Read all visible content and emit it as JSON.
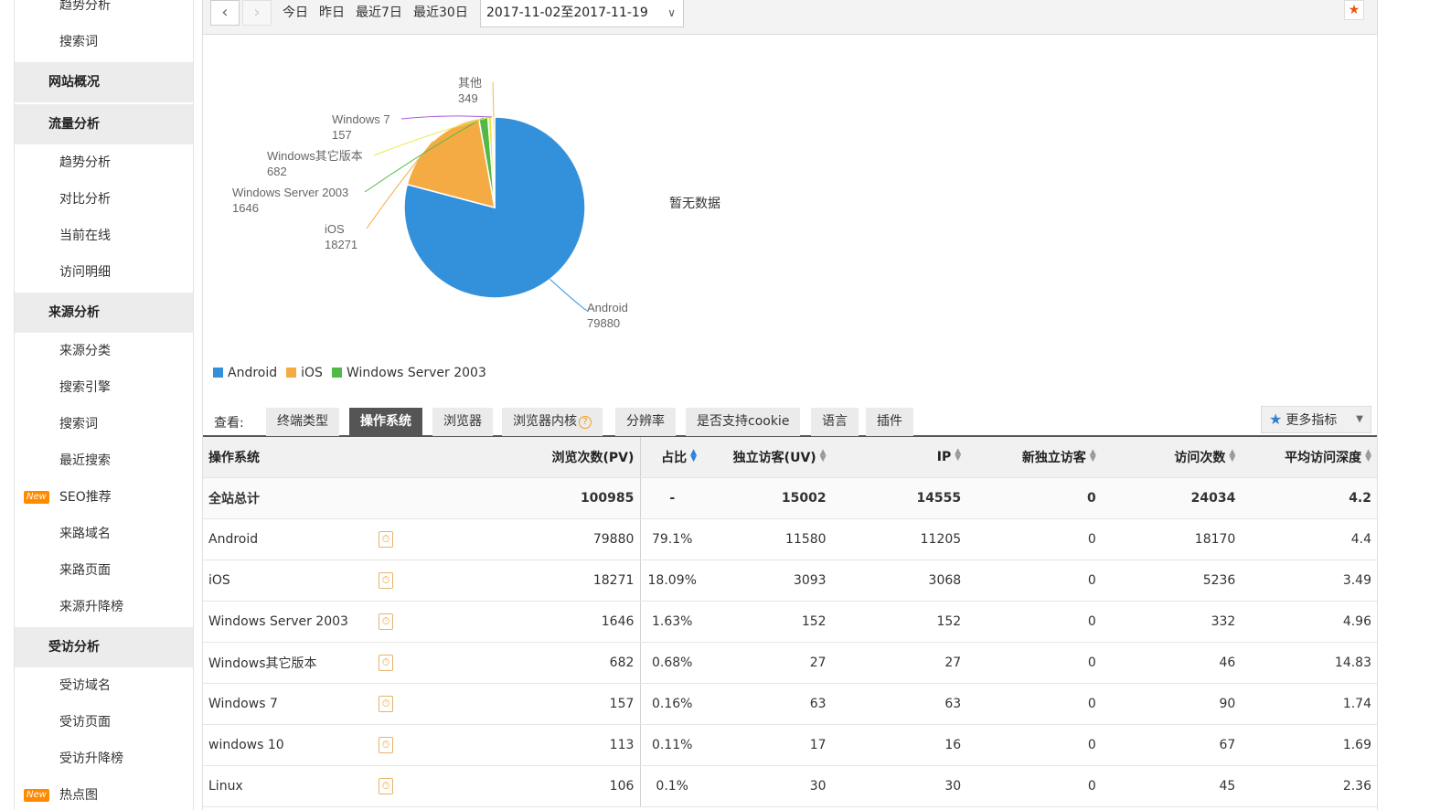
{
  "sidebar": {
    "items": [
      {
        "label": "趋势分析",
        "type": "item"
      },
      {
        "label": "搜索词",
        "type": "item"
      },
      {
        "label": "网站概况",
        "type": "group"
      },
      {
        "label": "流量分析",
        "type": "group"
      },
      {
        "label": "趋势分析",
        "type": "item"
      },
      {
        "label": "对比分析",
        "type": "item"
      },
      {
        "label": "当前在线",
        "type": "item"
      },
      {
        "label": "访问明细",
        "type": "item"
      },
      {
        "label": "来源分析",
        "type": "group"
      },
      {
        "label": "来源分类",
        "type": "item"
      },
      {
        "label": "搜索引擎",
        "type": "item"
      },
      {
        "label": "搜索词",
        "type": "item"
      },
      {
        "label": "最近搜索",
        "type": "item"
      },
      {
        "label": "SEO推荐",
        "type": "item",
        "badge": "New"
      },
      {
        "label": "来路域名",
        "type": "item"
      },
      {
        "label": "来路页面",
        "type": "item"
      },
      {
        "label": "来源升降榜",
        "type": "item"
      },
      {
        "label": "受访分析",
        "type": "group"
      },
      {
        "label": "受访域名",
        "type": "item"
      },
      {
        "label": "受访页面",
        "type": "item"
      },
      {
        "label": "受访升降榜",
        "type": "item"
      },
      {
        "label": "热点图",
        "type": "item",
        "badge": "New"
      }
    ]
  },
  "toolbar": {
    "prev_icon": "chevron-left-icon",
    "next_icon": "chevron-right-icon",
    "today": "今日",
    "yesterday": "昨日",
    "last7": "最近7日",
    "last30": "最近30日",
    "date_range": "2017-11-02至2017-11-19",
    "pin_icon": "pin-icon"
  },
  "chart_data": {
    "type": "pie",
    "slices": [
      {
        "label": "Android",
        "value": 79880,
        "color": "#3391db"
      },
      {
        "label": "iOS",
        "value": 18271,
        "color": "#f5ab43"
      },
      {
        "label": "Windows Server 2003",
        "value": 1646,
        "color": "#52b947"
      },
      {
        "label": "Windows其它版本",
        "value": 682,
        "color": "#e9e94b"
      },
      {
        "label": "Windows 7",
        "value": 157,
        "color": "#a958d6"
      },
      {
        "label": "其他",
        "value": 349,
        "color": "#f4b84a"
      }
    ],
    "legend": [
      "Android",
      "iOS",
      "Windows Server 2003"
    ],
    "legend_placement": "bottom-left"
  },
  "nodata_text": "暂无数据",
  "tabs": {
    "label": "查看:",
    "items": [
      "终端类型",
      "操作系统",
      "浏览器",
      "浏览器内核",
      "分辨率",
      "是否支持cookie",
      "语言",
      "插件"
    ],
    "active": "操作系统",
    "help_mark": "?",
    "more_label": "更多指标"
  },
  "table": {
    "headers": [
      "操作系统",
      "浏览次数(PV)",
      "占比",
      "独立访客(UV)",
      "IP",
      "新独立访客",
      "访问次数",
      "平均访问深度"
    ],
    "total": [
      "全站总计",
      "100985",
      "-",
      "15002",
      "14555",
      "0",
      "24034",
      "4.2"
    ],
    "rows": [
      [
        "Android",
        "79880",
        "79.1%",
        "11580",
        "11205",
        "0",
        "18170",
        "4.4"
      ],
      [
        "iOS",
        "18271",
        "18.09%",
        "3093",
        "3068",
        "0",
        "5236",
        "3.49"
      ],
      [
        "Windows Server 2003",
        "1646",
        "1.63%",
        "152",
        "152",
        "0",
        "332",
        "4.96"
      ],
      [
        "Windows其它版本",
        "682",
        "0.68%",
        "27",
        "27",
        "0",
        "46",
        "14.83"
      ],
      [
        "Windows 7",
        "157",
        "0.16%",
        "63",
        "63",
        "0",
        "90",
        "1.74"
      ],
      [
        "windows 10",
        "113",
        "0.11%",
        "17",
        "16",
        "0",
        "67",
        "1.69"
      ],
      [
        "Linux",
        "106",
        "0.1%",
        "30",
        "30",
        "0",
        "45",
        "2.36"
      ]
    ]
  }
}
